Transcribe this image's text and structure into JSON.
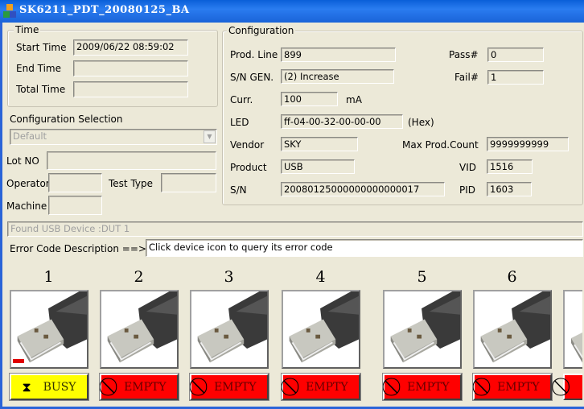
{
  "window": {
    "title": "SK6211_PDT_20080125_BA"
  },
  "time": {
    "group": "Time",
    "start_label": "Start Time",
    "start_value": "2009/06/22 08:59:02",
    "end_label": "End Time",
    "end_value": "",
    "total_label": "Total Time",
    "total_value": ""
  },
  "selection": {
    "label": "Configuration Selection",
    "value": "Default"
  },
  "lot": {
    "label": "Lot NO",
    "value": ""
  },
  "operator": {
    "label": "Operator",
    "value": ""
  },
  "test_type": {
    "label": "Test Type",
    "value": ""
  },
  "machine": {
    "label": "Machine",
    "value": ""
  },
  "config": {
    "group": "Configuration",
    "prod_line_label": "Prod. Line",
    "prod_line": "899",
    "sn_gen_label": "S/N GEN.",
    "sn_gen": "(2) Increase",
    "curr_label": "Curr.",
    "curr": "100",
    "curr_unit": "mA",
    "led_label": "LED",
    "led": "ff-04-00-32-00-00-00",
    "led_unit": "(Hex)",
    "vendor_label": "Vendor",
    "vendor": "SKY",
    "product_label": "Product",
    "product": "USB",
    "sn_label": "S/N",
    "sn": "20080125000000000000017",
    "pass_label": "Pass#",
    "pass": "0",
    "fail_label": "Fail#",
    "fail": "1",
    "max_label": "Max Prod.Count",
    "max": "9999999999",
    "vid_label": "VID",
    "vid": "1516",
    "pid_label": "PID",
    "pid": "1603"
  },
  "status": "Found USB Device :DUT 1",
  "error": {
    "label": "Error Code Description ==>",
    "value": "Click device icon to query its error code"
  },
  "slots": [
    {
      "num": "1",
      "state": "BUSY",
      "icon": "hourglass-icon"
    },
    {
      "num": "2",
      "state": "EMPTY",
      "icon": "no-entry-icon"
    },
    {
      "num": "3",
      "state": "EMPTY",
      "icon": "no-entry-icon"
    },
    {
      "num": "4",
      "state": "EMPTY",
      "icon": "no-entry-icon"
    },
    {
      "num": "5",
      "state": "EMPTY",
      "icon": "no-entry-icon"
    },
    {
      "num": "6",
      "state": "EMPTY",
      "icon": "no-entry-icon"
    },
    {
      "num": "",
      "state": "",
      "icon": "no-entry-icon"
    }
  ],
  "colors": {
    "busy": "#ffff00",
    "empty": "#ff0000",
    "titlebar": "#0a5fd8"
  }
}
